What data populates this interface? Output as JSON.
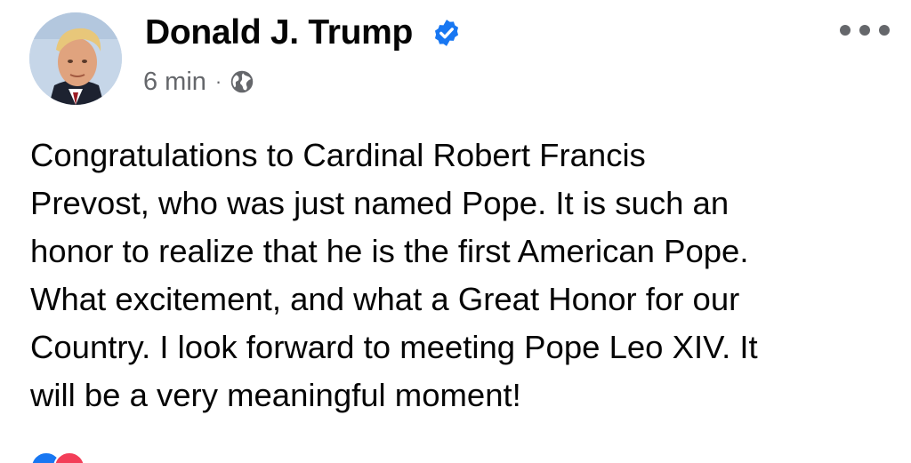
{
  "post": {
    "author": {
      "name": "Donald J. Trump",
      "verified": true,
      "avatar": "profile-photo"
    },
    "timestamp": "6 min",
    "separator": "·",
    "audience_icon": "globe-icon",
    "more_icon": "more-options-icon",
    "text_lines": [
      "Congratulations to Cardinal Robert Francis",
      "Prevost, who was just named Pope. It is such an",
      "honor to realize that he is the first American Pope.",
      "What excitement, and what a Great Honor for our",
      "Country. I look forward to meeting Pope Leo XIV. It",
      "will be a very meaningful moment!"
    ]
  },
  "colors": {
    "verified_badge": "#1877f2",
    "secondary_text": "#65676b",
    "primary_text": "#050505",
    "like": "#1877f2",
    "love": "#f33e58"
  }
}
